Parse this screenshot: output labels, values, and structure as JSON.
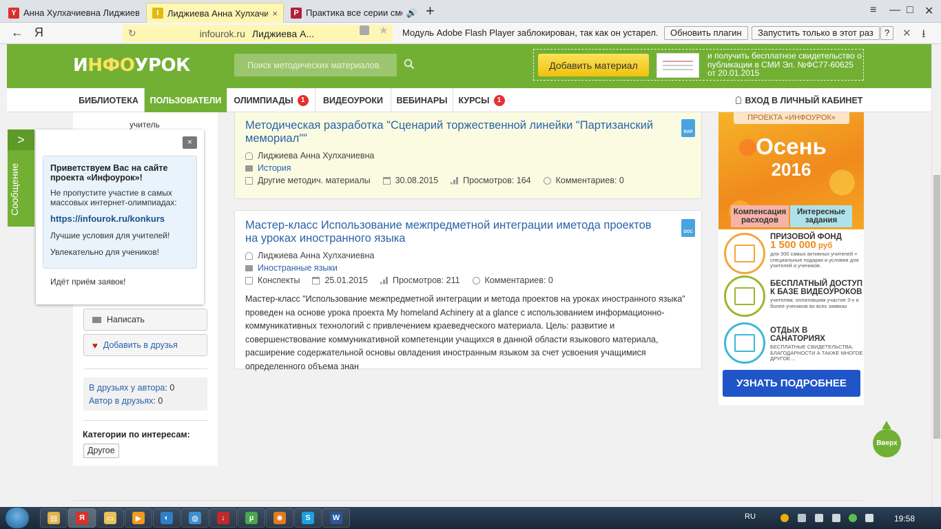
{
  "browser": {
    "tabs": [
      {
        "favicon": "Y",
        "favicon_color": "#d9302e",
        "title": "Анна Хулхачиевна Лиджиева",
        "close": "×"
      },
      {
        "favicon": "I",
        "favicon_color": "#e3b90e",
        "title": "Лиджиева Анна Хулхачиевна",
        "close": "×"
      },
      {
        "favicon": "P",
        "favicon_color": "#b0203a",
        "title": "Практика все серии смо",
        "close": "🔊"
      }
    ],
    "new_tab": "+",
    "window_controls": [
      "≡",
      "—",
      "□",
      "✕"
    ],
    "back": "←",
    "yandex": "Я",
    "reload": "↻",
    "url_domain": "infourok.ru",
    "url_title": "Лиджиева А...",
    "star": "★",
    "flash_message": "Модуль Adobe Flash Player заблокирован, так как он устарел.",
    "update_plugin": "Обновить плагин",
    "run_once": "Запустить только в этот раз",
    "help": "?",
    "close_bar": "✕",
    "download": "⭳"
  },
  "header": {
    "logo_i": "И",
    "logo_part1": "НФО",
    "logo_part2": "УРОК",
    "search_placeholder": "Поиск методических материалов.",
    "add_material": "Добавить материал",
    "promo_text": "и получить бесплатное свидетельство о публикации в СМИ Эл. №ФС77-60625 от 20.01.2015"
  },
  "nav": {
    "items": [
      {
        "label": "Библиотека"
      },
      {
        "label": "Пользователи"
      },
      {
        "label": "Олимпиады",
        "badge": "1"
      },
      {
        "label": "Видеоуроки"
      },
      {
        "label": "Вебинары"
      },
      {
        "label": "Курсы",
        "badge": "1"
      }
    ],
    "login": "Вход в личный кабинет"
  },
  "sidebar": {
    "role": "учитель",
    "write": "Написать",
    "add_friend": "Добавить в друзья",
    "friends_of_author_label": "В друзьях у автора",
    "friends_of_author_value": ": 0",
    "author_in_friends_label": "Автор в друзьях",
    "author_in_friends_value": ": 0",
    "categories_title": "Категории по интересам:",
    "category": "Другое"
  },
  "popup": {
    "tab_arrow": ">",
    "tab_label": "Сообщение",
    "close": "×",
    "title": "Приветствуем Вас на сайте проекта «Инфоурок»!",
    "text1": "Не пропустите участие в самых массовых интернет-олимпиадах:",
    "link": "https://infourok.ru/konkurs",
    "text2": "Лучшие условия для учителей!",
    "text3": "Увлекательно для учеников!",
    "footer": "Идёт приём заявок!"
  },
  "cards": [
    {
      "title": "Методическая разработка \"Сценарий торжественной линейки \"Партизанский мемориал\"\"",
      "file_type": "RAR",
      "file_color": "#4aa3e0",
      "author": "Лиджиева Анна Хулхачиевна",
      "subject": "История",
      "type": "Другие методич. материалы",
      "date": "30.08.2015",
      "views": "Просмотров: 164",
      "comments": "Комментариев: 0"
    },
    {
      "title": "Мастер-класс Использование межпредметной интеграции иметода проектов на уроках иностранного языка",
      "file_type": "DOC",
      "file_color": "#4aa3e0",
      "author": "Лиджиева Анна Хулхачиевна",
      "subject": "Иностранные языки",
      "type": "Конспекты",
      "date": "25.01.2015",
      "views": "Просмотров: 211",
      "comments": "Комментариев: 0",
      "description": "Мастер-класс \"Использование межпредметной интеграции и метода проектов на уроках иностранного языка\" проведен на основе урока проекта My homeland Achinery at a glance с использованием информационно-коммуникативных технологий с привлечением краеведческого материала. Цель: развитие и совершенствование коммуникативной компетенции учащихся в данной области языкового материала, расширение содержательной основы овладения иностранным языком за счет усвоения учащимися определенного объема знан"
    }
  ],
  "banner": {
    "project": "ПРОЕКТА «ИНФОУРОК»",
    "season": "Осень",
    "year": "2016",
    "compensation": "Компенсация расходов",
    "tasks": "Интересные задания",
    "prize_title": "ПРИЗОВОЙ ФОНД",
    "prize_amount": "1 500 000",
    "prize_currency": "руб",
    "prize_sub": "для 300 самых активных учителей + специальные подарки и условия для учителей и учеников.",
    "video_title": "БЕСПЛАТНЫЙ ДОСТУП К БАЗЕ ВИДЕОУРОКОВ",
    "video_sub": "учителям, оплатившим участие 3-х и более учеников во всех заявках",
    "rest_title": "ОТДЫХ В САНАТОРИЯХ",
    "rest_sub": "БЕСПЛАТНЫЕ СВИДЕТЕЛЬСТВА, БЛАГОДАРНОСТИ А ТАКЖЕ МНОГОЕ ДРУГОЕ...",
    "cta": "УЗНАТЬ ПОДРОБНЕЕ"
  },
  "up_button": "Вверх",
  "taskbar": {
    "apps": [
      {
        "icon": "folder-icon",
        "glyph": "▤",
        "color": "#e2b34a"
      },
      {
        "icon": "yandex-browser-icon",
        "glyph": "Я",
        "color": "#d9302e"
      },
      {
        "icon": "explorer-icon",
        "glyph": "▭",
        "color": "#e8c25a"
      },
      {
        "icon": "media-player-icon",
        "glyph": "▶",
        "color": "#f29a1f"
      },
      {
        "icon": "browser-icon",
        "glyph": "◐",
        "color": "#2f7fc8"
      },
      {
        "icon": "shield-icon",
        "glyph": "◍",
        "color": "#3d8fcf"
      },
      {
        "icon": "download-manager-icon",
        "glyph": "↓",
        "color": "#c02a2a"
      },
      {
        "icon": "torrent-icon",
        "glyph": "µ",
        "color": "#4aa64a"
      },
      {
        "icon": "wheel-icon",
        "glyph": "✺",
        "color": "#e07b1e"
      },
      {
        "icon": "skype-icon",
        "glyph": "S",
        "color": "#1ba1e2"
      },
      {
        "icon": "word-icon",
        "glyph": "W",
        "color": "#2b5797"
      }
    ],
    "lang": "RU",
    "time": "19:58"
  }
}
